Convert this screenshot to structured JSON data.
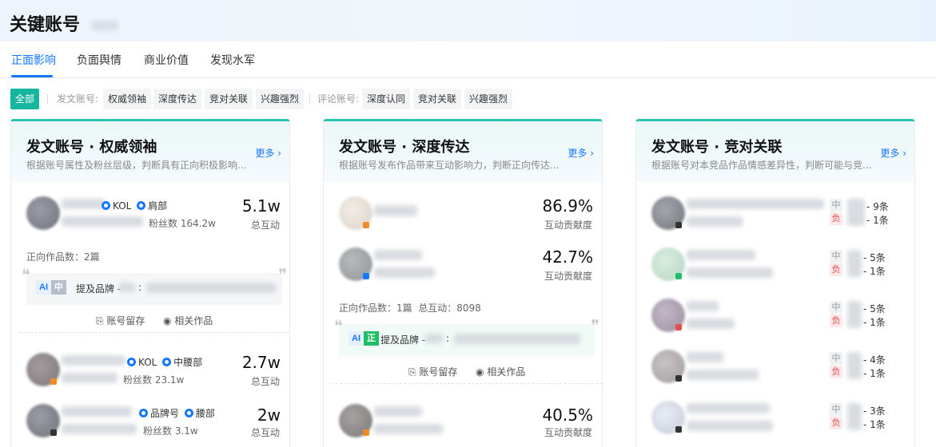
{
  "header": {
    "title": "关键账号"
  },
  "tabs": [
    {
      "label": "正面影响",
      "active": true
    },
    {
      "label": "负面舆情"
    },
    {
      "label": "商业价值"
    },
    {
      "label": "发现水军"
    }
  ],
  "filters": {
    "all": "全部",
    "post_label": "发文账号:",
    "post_chips": [
      "权威领袖",
      "深度传达",
      "竞对关联",
      "兴趣强烈"
    ],
    "comment_label": "评论账号:",
    "comment_chips": [
      "深度认同",
      "竞对关联",
      "兴趣强烈"
    ]
  },
  "common": {
    "more": "更多 ›",
    "account_keep": "账号留存",
    "related_works": "相关作品",
    "mention_brand": "提及品牌 -",
    "colon": ":",
    "ai": "AI",
    "level_mid": "中",
    "level_pos": "正",
    "sent_mid": "中",
    "sent_neg": "负"
  },
  "card1": {
    "title": "发文账号 · 权威领袖",
    "desc": "根据账号属性及粉丝层级，判断具有正向积极影响...",
    "accounts": [
      {
        "type": "KOL",
        "tier": "肩部",
        "fans": "粉丝数 164.2w",
        "value": "5.1w",
        "value_label": "总互动"
      },
      {
        "type": "KOL",
        "tier": "中腰部",
        "fans": "粉丝数 23.1w",
        "value": "2.7w",
        "value_label": "总互动"
      },
      {
        "type": "品牌号",
        "tier": "腰部",
        "fans": "粉丝数 3.1w",
        "value": "2w",
        "value_label": "总互动"
      }
    ],
    "works_count": "正向作品数：2篇"
  },
  "card2": {
    "title": "发文账号 · 深度传达",
    "desc": "根据账号发布作品带来互动影响力，判断正向传达...",
    "accounts": [
      {
        "value": "86.9%",
        "value_label": "互动贡献度"
      },
      {
        "value": "42.7%",
        "value_label": "互动贡献度"
      },
      {
        "value": "40.5%",
        "value_label": "互动贡献度"
      }
    ],
    "works_count": "正向作品数：1篇",
    "total_interaction": "总互动：8098"
  },
  "card3": {
    "title": "发文账号 · 竞对关联",
    "desc": "根据账号对本竞品作品情感差异性，判断可能与竞...",
    "accounts": [
      {
        "mid": "9条",
        "neg": "1条"
      },
      {
        "mid": "5条",
        "neg": "1条"
      },
      {
        "mid": "5条",
        "neg": "1条"
      },
      {
        "mid": "4条",
        "neg": "1条"
      },
      {
        "mid": "3条",
        "neg": "1条"
      }
    ]
  },
  "colors": {
    "accent": "#1677ff",
    "teal": "#16b59f",
    "negative": "#e34d4d",
    "positive": "#1fbf6a"
  }
}
